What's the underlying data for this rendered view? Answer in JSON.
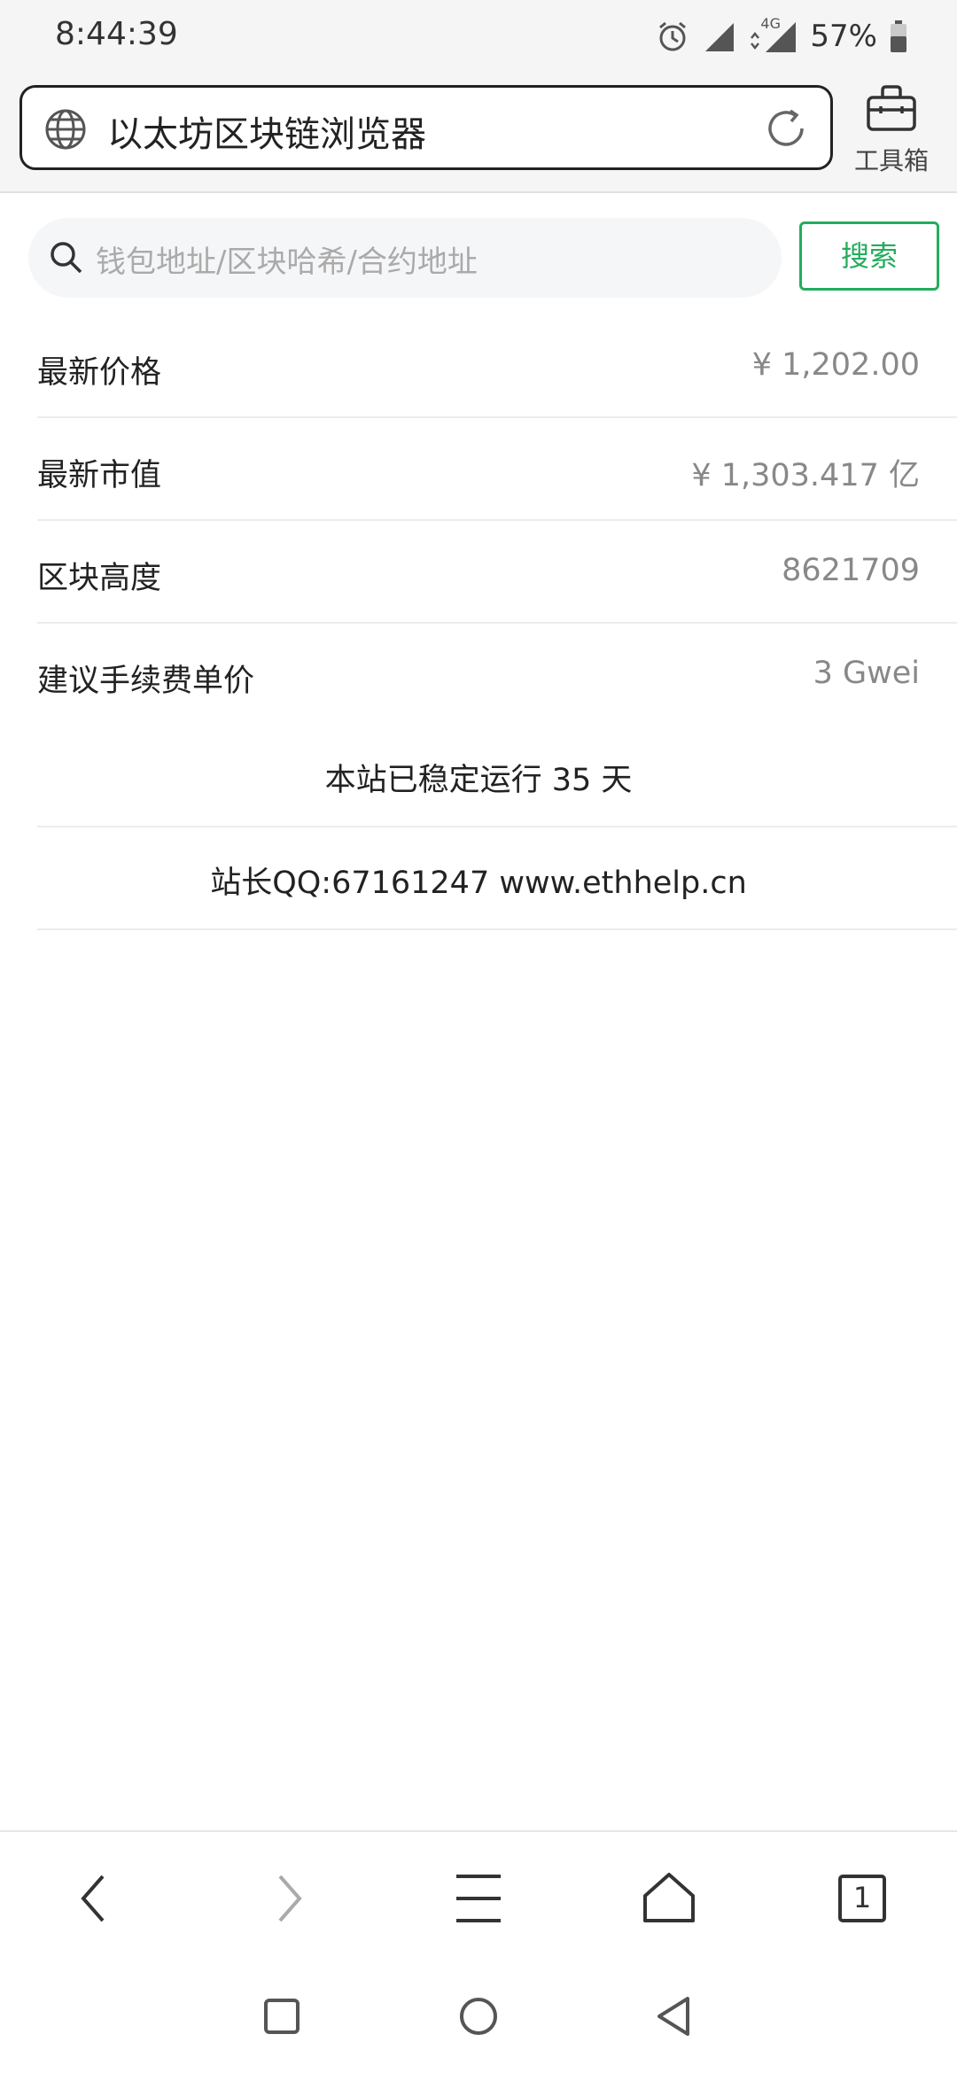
{
  "status_bar": {
    "time": "8:44:39",
    "network": "4G",
    "battery": "57%",
    "icons": [
      "alarm-icon",
      "signal-icon",
      "signal-4g-icon",
      "battery-icon"
    ]
  },
  "toolbar": {
    "page_title": "以太坊区块链浏览器",
    "toolbox_label": "工具箱"
  },
  "search": {
    "placeholder": "钱包地址/区块哈希/合约地址",
    "button_label": "搜索"
  },
  "info": {
    "rows": [
      {
        "label": "最新价格",
        "value": "¥ 1,202.00"
      },
      {
        "label": "最新市值",
        "value": "¥ 1,303.417 亿"
      },
      {
        "label": "区块高度",
        "value": "8621709"
      },
      {
        "label": "建议手续费单价",
        "value": "3 Gwei"
      }
    ],
    "uptime_text": "本站已稳定运行 35 天",
    "contact_text": "站长QQ:67161247 www.ethhelp.cn"
  },
  "bottom_nav": {
    "tab_count": "1"
  },
  "colors": {
    "accent": "#22ad5c",
    "muted_text": "#888888",
    "divider": "#ececec"
  }
}
